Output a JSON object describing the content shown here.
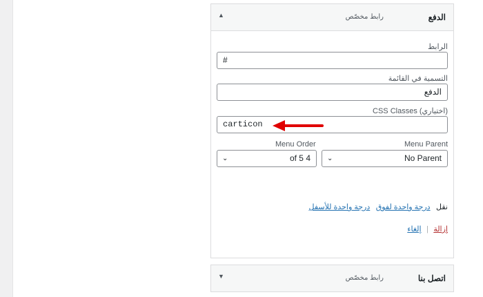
{
  "item_payment": {
    "title": "الدفع",
    "type": "رابط مخصّص",
    "toggle": "▲",
    "url_label": "الرابط",
    "url_value": "#",
    "nav_label_label": "التسمية في القائمة",
    "nav_label_value": "الدفع",
    "css_label": "CSS Classes (اختياري)",
    "css_value": "carticon",
    "menu_order_label": "Menu Order",
    "menu_order_value": "of 5 4",
    "menu_parent_label": "Menu Parent",
    "menu_parent_value": "No Parent",
    "move_label": "نقل",
    "move_up": "درجة واحدة لفوق",
    "move_down": "درجة واحدة للأسفل",
    "remove": "إزالة",
    "separator": "|",
    "cancel": "إلغاء"
  },
  "item_contact": {
    "title": "اتصل بنا",
    "type": "رابط مخصّص",
    "toggle": "▼"
  },
  "colors": {
    "link": "#2271b1",
    "remove": "#b32d2e",
    "arrow": "#e00000"
  }
}
